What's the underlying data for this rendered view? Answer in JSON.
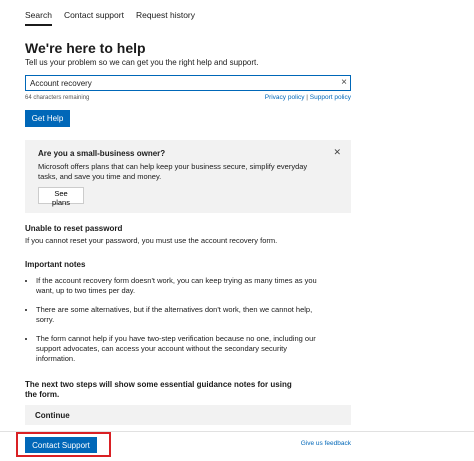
{
  "tabs": [
    {
      "label": "Search",
      "active": true
    },
    {
      "label": "Contact support",
      "active": false
    },
    {
      "label": "Request history",
      "active": false
    }
  ],
  "header": {
    "title": "We're here to help",
    "subtitle": "Tell us your problem so we can get you the right help and support."
  },
  "search": {
    "value": "Account recovery",
    "clear_icon": "×",
    "chars_remaining": "64 characters remaining"
  },
  "links": {
    "privacy": "Privacy policy",
    "separator": "|",
    "support": "Support policy"
  },
  "get_help_label": "Get Help",
  "promo": {
    "title": "Are you a small-business owner?",
    "text": "Microsoft offers plans that can help keep your business secure, simplify everyday tasks, and save you time and money.",
    "close_icon": "✕",
    "button": "See plans"
  },
  "reset": {
    "heading": "Unable to reset password",
    "text": "If you cannot reset your password, you must use the account recovery form."
  },
  "notes": {
    "heading": "Important notes",
    "items": [
      "If the account recovery form doesn't work, you can keep trying as many times as you want, up to two times per day.",
      "There are some alternatives, but if the alternatives don't work, then we cannot help, sorry.",
      "The form cannot help if you have two-step verification because no one, including our support advocates, can access your account without the secondary security information."
    ]
  },
  "next_steps": "The next two steps will show some essential guidance notes for using the form.",
  "continue_label": "Continue",
  "footer": {
    "contact_label": "Contact Support",
    "feedback": "Give us feedback"
  },
  "colors": {
    "accent": "#0067b8",
    "highlight": "#d92024",
    "panel": "#f2f2f2"
  }
}
